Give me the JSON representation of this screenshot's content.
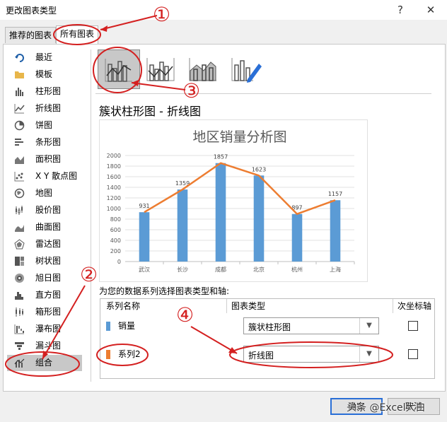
{
  "window": {
    "title": "更改图表类型",
    "help": "?",
    "close": "✕"
  },
  "tabs": [
    {
      "label": "推荐的图表"
    },
    {
      "label": "所有图表"
    }
  ],
  "sidebar": {
    "items": [
      {
        "label": "最近",
        "icon": "recent-icon"
      },
      {
        "label": "模板",
        "icon": "folder-icon"
      },
      {
        "label": "柱形图",
        "icon": "column-chart-icon"
      },
      {
        "label": "折线图",
        "icon": "line-chart-icon"
      },
      {
        "label": "饼图",
        "icon": "pie-chart-icon"
      },
      {
        "label": "条形图",
        "icon": "bar-chart-icon"
      },
      {
        "label": "面积图",
        "icon": "area-chart-icon"
      },
      {
        "label": "X Y 散点图",
        "icon": "scatter-chart-icon"
      },
      {
        "label": "地图",
        "icon": "map-chart-icon"
      },
      {
        "label": "股价图",
        "icon": "stock-chart-icon"
      },
      {
        "label": "曲面图",
        "icon": "surface-chart-icon"
      },
      {
        "label": "雷达图",
        "icon": "radar-chart-icon"
      },
      {
        "label": "树状图",
        "icon": "treemap-chart-icon"
      },
      {
        "label": "旭日图",
        "icon": "sunburst-chart-icon"
      },
      {
        "label": "直方图",
        "icon": "histogram-chart-icon"
      },
      {
        "label": "箱形图",
        "icon": "box-chart-icon"
      },
      {
        "label": "瀑布图",
        "icon": "waterfall-chart-icon"
      },
      {
        "label": "漏斗图",
        "icon": "funnel-chart-icon"
      },
      {
        "label": "组合",
        "icon": "combo-chart-icon"
      }
    ],
    "selected": 18
  },
  "subtypes": {
    "selected": 0,
    "name": "簇状柱形图 - 折线图"
  },
  "chart_data": {
    "type": "bar",
    "title": "地区销量分析图",
    "categories": [
      "武汉",
      "长沙",
      "成都",
      "北京",
      "杭州",
      "上海"
    ],
    "series": [
      {
        "values": [
          931,
          1359,
          1857,
          1623,
          897,
          1157
        ],
        "kind": "bar",
        "color": "#5b9bd5"
      },
      {
        "values": [
          931,
          1359,
          1857,
          1623,
          897,
          1157
        ],
        "kind": "line",
        "color": "#ed7d31"
      }
    ],
    "ylim": [
      0,
      2000
    ],
    "yticks": [
      0,
      200,
      400,
      600,
      800,
      1000,
      1200,
      1400,
      1600,
      1800,
      2000
    ],
    "grid": true
  },
  "series_config": {
    "prompt": "为您的数据系列选择图表类型和轴:",
    "headers": {
      "name": "系列名称",
      "type": "图表类型",
      "secondary": "次坐标轴"
    },
    "rows": [
      {
        "name": "销量",
        "color": "#5b9bd5",
        "type": "簇状柱形图",
        "secondary": false
      },
      {
        "name": "系列2",
        "color": "#ed7d31",
        "type": "折线图",
        "secondary": false
      }
    ]
  },
  "buttons": {
    "ok": "确定",
    "cancel": "取消"
  },
  "watermark": "头条 @Excel大白",
  "annotations": {
    "m1": "①",
    "m2": "②",
    "m3": "③",
    "m4": "④",
    "color": "#d42020"
  }
}
